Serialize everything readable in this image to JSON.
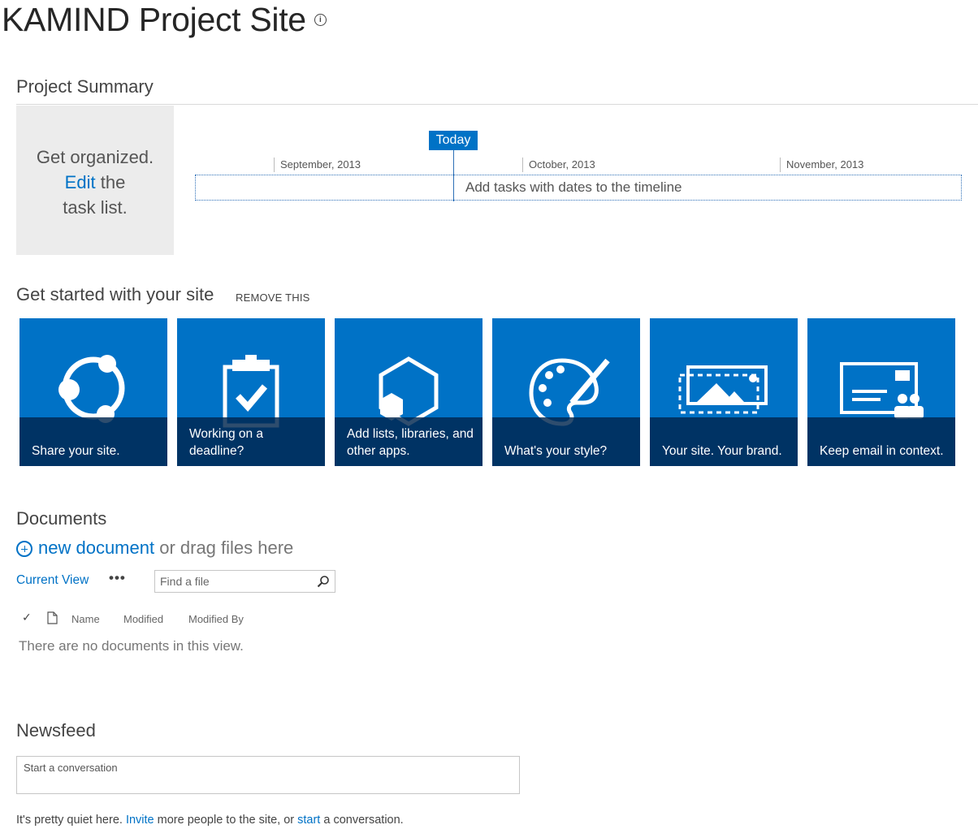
{
  "site": {
    "title": "KAMIND Project Site",
    "info_icon": "i"
  },
  "project_summary": {
    "heading": "Project Summary",
    "organize": {
      "line1": "Get organized.",
      "edit_link": "Edit",
      "line2": "the",
      "line3": "task list."
    },
    "timeline": {
      "today_label": "Today",
      "months": [
        "September, 2013",
        "October, 2013",
        "November, 2013"
      ],
      "placeholder": "Add tasks with dates to the timeline"
    }
  },
  "get_started": {
    "heading": "Get started with your site",
    "remove_label": "REMOVE THIS",
    "tiles": [
      {
        "label": "Share your site.",
        "icon": "share-icon"
      },
      {
        "label": "Working on a deadline?",
        "icon": "clipboard-check-icon"
      },
      {
        "label": "Add lists, libraries, and other apps.",
        "icon": "apps-hexagon-icon"
      },
      {
        "label": "What's your style?",
        "icon": "palette-icon"
      },
      {
        "label": "Your site. Your brand.",
        "icon": "brand-image-icon"
      },
      {
        "label": "Keep email in context.",
        "icon": "email-context-icon"
      }
    ]
  },
  "documents": {
    "heading": "Documents",
    "new_link": "new document",
    "new_suffix": " or drag files here",
    "current_view": "Current View",
    "more": "•••",
    "find_placeholder": "Find a file",
    "columns": {
      "check": "✓",
      "name": "Name",
      "modified": "Modified",
      "modified_by": "Modified By"
    },
    "empty_message": "There are no documents in this view."
  },
  "newsfeed": {
    "heading": "Newsfeed",
    "placeholder": "Start a conversation",
    "quiet_1": "It's pretty quiet here. ",
    "invite_link": "Invite",
    "quiet_2": " more people to the site, or ",
    "start_link": "start",
    "quiet_3": " a conversation."
  },
  "colors": {
    "accent": "#0072c6",
    "tile_caption": "#00264e",
    "org_box": "#ececec"
  }
}
